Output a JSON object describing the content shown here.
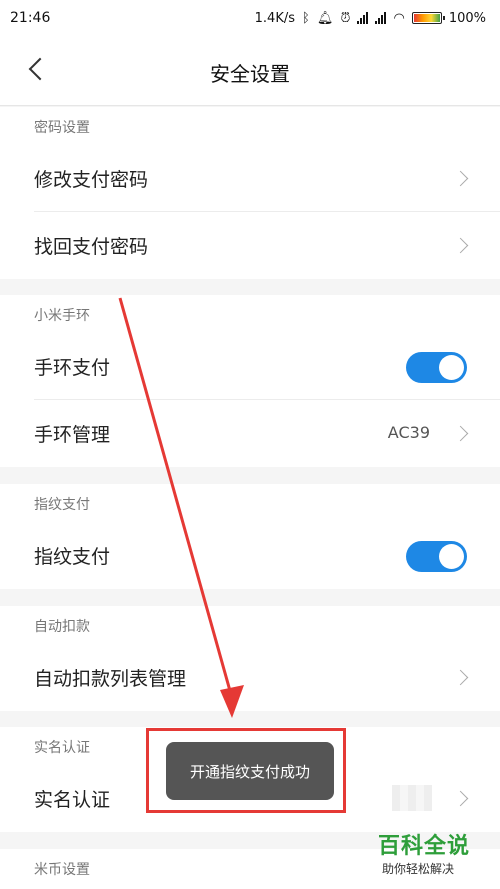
{
  "status_bar": {
    "time": "21:46",
    "net_speed": "1.4K/s",
    "battery": "100%",
    "icons": [
      "bluetooth-icon",
      "mute-icon",
      "alarm-icon",
      "signal-icon",
      "wifi-icon",
      "battery-icon"
    ]
  },
  "header": {
    "title": "安全设置"
  },
  "sections": {
    "password": {
      "title": "密码设置",
      "change_pay_password": "修改支付密码",
      "recover_pay_password": "找回支付密码"
    },
    "mi_band": {
      "title": "小米手环",
      "band_pay": "手环支付",
      "band_manage": "手环管理",
      "band_id": "AC39"
    },
    "fingerprint": {
      "title": "指纹支付",
      "fingerprint_pay": "指纹支付"
    },
    "auto_debit": {
      "title": "自动扣款",
      "auto_debit_list": "自动扣款列表管理"
    },
    "real_name": {
      "title": "实名认证",
      "real_name_auth": "实名认证"
    },
    "mi_coin": {
      "title": "米币设置"
    }
  },
  "toast": {
    "message": "开通指纹支付成功"
  },
  "watermark": {
    "title": "百科全说",
    "subtitle": "助你轻松解决"
  },
  "colors": {
    "accent": "#1e88e5",
    "annotation": "#e53935",
    "watermark": "#2e9e3a"
  }
}
